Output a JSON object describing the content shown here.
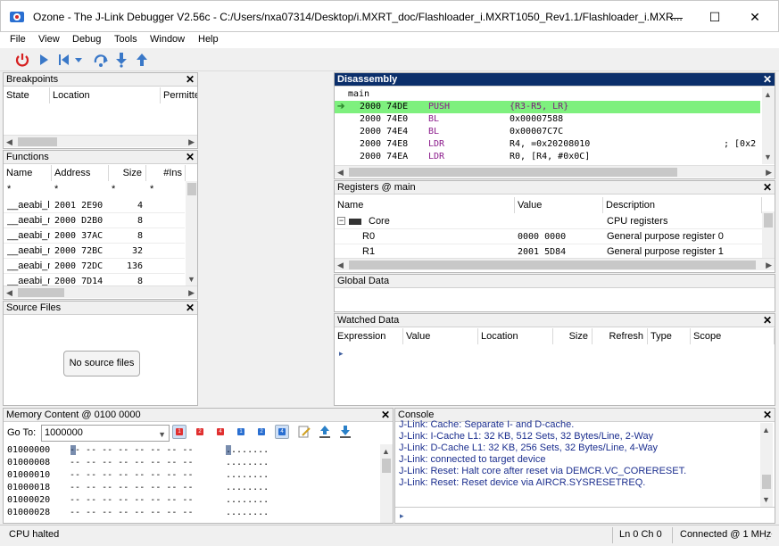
{
  "window": {
    "title": "Ozone - The J-Link Debugger V2.56c - C:/Users/nxa07314/Desktop/i.MXRT_doc/Flashloader_i.MXRT1050_Rev1.1/Flashloader_i.MXR...",
    "minimize": "—",
    "maximize": "☐",
    "close": "✕"
  },
  "menu": [
    "File",
    "View",
    "Debug",
    "Tools",
    "Window",
    "Help"
  ],
  "breakpoints": {
    "title": "Breakpoints",
    "columns": [
      "State",
      "Location",
      "Permitte"
    ]
  },
  "functions": {
    "title": "Functions",
    "columns": [
      "Name",
      "Address",
      "Size",
      "#Ins"
    ],
    "filters": [
      "*",
      "*",
      "*",
      "*"
    ],
    "rows": [
      {
        "name": "__aeabi_l",
        "address": "2001 2E90",
        "size": "4"
      },
      {
        "name": "__aeabi_n",
        "address": "2000 D2B0",
        "size": "8"
      },
      {
        "name": "__aeabi_n",
        "address": "2000 37AC",
        "size": "8"
      },
      {
        "name": "__aeabi_n",
        "address": "2000 72BC",
        "size": "32"
      },
      {
        "name": "__aeabi_n",
        "address": "2000 72DC",
        "size": "136"
      },
      {
        "name": "__aeabi_r",
        "address": "2000 7D14",
        "size": "8"
      }
    ]
  },
  "source_files": {
    "title": "Source Files",
    "empty_button": "No source files"
  },
  "disassembly": {
    "title": "Disassembly",
    "label": "main",
    "rows": [
      {
        "addr": "2000 74DE",
        "mnem": "PUSH",
        "ops": "{R3-R5, LR}",
        "comment": "",
        "current": true
      },
      {
        "addr": "2000 74E0",
        "mnem": "BL",
        "ops": "0x00007588",
        "comment": "",
        "current": false
      },
      {
        "addr": "2000 74E4",
        "mnem": "BL",
        "ops": "0x00007C7C",
        "comment": "",
        "current": false
      },
      {
        "addr": "2000 74E8",
        "mnem": "LDR",
        "ops": "R4, =0x20208010",
        "comment": "; [0x2",
        "current": false
      },
      {
        "addr": "2000 74EA",
        "mnem": "LDR",
        "ops": "R0, [R4, #0x0C]",
        "comment": "",
        "current": false
      }
    ]
  },
  "registers": {
    "title": "Registers @ main",
    "columns": [
      "Name",
      "Value",
      "Description"
    ],
    "rows": [
      {
        "name": "Core",
        "value": "",
        "desc": "CPU registers",
        "group": true
      },
      {
        "name": "R0",
        "value": "0000 0000",
        "desc": "General purpose register 0",
        "group": false
      },
      {
        "name": "R1",
        "value": "2001 5D84",
        "desc": "General purpose register 1",
        "group": false
      }
    ]
  },
  "global_data": {
    "title": "Global Data"
  },
  "watched_data": {
    "title": "Watched Data",
    "columns": [
      "Expression",
      "Value",
      "Location",
      "Size",
      "Refresh",
      "Type",
      "Scope"
    ]
  },
  "memory": {
    "title": "Memory Content @ 0100 0000",
    "goto_label": "Go To:",
    "goto_value": "1000000",
    "rows": [
      {
        "addr": "01000000",
        "bytes": "-- -- -- -- -- -- -- --",
        "ascii": "........"
      },
      {
        "addr": "01000008",
        "bytes": "-- -- -- -- -- -- -- --",
        "ascii": "........"
      },
      {
        "addr": "01000010",
        "bytes": "-- -- -- -- -- -- -- --",
        "ascii": "........"
      },
      {
        "addr": "01000018",
        "bytes": "-- -- -- -- -- -- -- --",
        "ascii": "........"
      },
      {
        "addr": "01000020",
        "bytes": "-- -- -- -- -- -- -- --",
        "ascii": "........"
      },
      {
        "addr": "01000028",
        "bytes": "-- -- -- -- -- -- -- --",
        "ascii": "........"
      }
    ],
    "size_buttons": [
      "1",
      "2",
      "4",
      "1",
      "2",
      "4"
    ]
  },
  "console": {
    "title": "Console",
    "lines": [
      "J-Link: Cache: Separate I- and D-cache.",
      "J-Link: I-Cache L1: 32 KB, 512 Sets, 32 Bytes/Line, 2-Way",
      "J-Link: D-Cache L1: 32 KB, 256 Sets, 32 Bytes/Line, 4-Way",
      "J-Link: connected to target device",
      "J-Link: Reset: Halt core after reset via DEMCR.VC_CORERESET.",
      "J-Link: Reset: Reset device via AIRCR.SYSRESETREQ."
    ]
  },
  "status": {
    "state": "CPU halted",
    "position": "Ln 0  Ch 0",
    "connection": "Connected @ 1 MHz"
  },
  "colors": {
    "active_header": "#0b2f6b",
    "current_line": "#7ef07e",
    "console_text": "#1c2f8f",
    "mnemonic": "#8b1a8b"
  }
}
